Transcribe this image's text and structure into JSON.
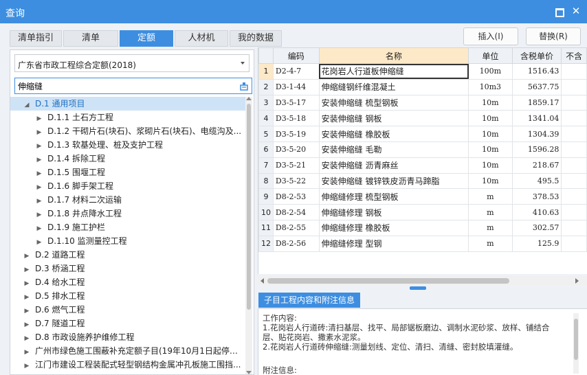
{
  "window": {
    "title": "查询"
  },
  "tabs": [
    {
      "label": "清单指引"
    },
    {
      "label": "清单"
    },
    {
      "label": "定额"
    },
    {
      "label": "人材机"
    },
    {
      "label": "我的数据"
    }
  ],
  "actions": {
    "insert_label": "插入(I)",
    "replace_label": "替换(R)"
  },
  "left": {
    "library": "广东省市政工程综合定额(2018)",
    "search_value": "伸缩缝",
    "tree": [
      {
        "label": "D.1 通用项目",
        "level": 0,
        "expanded": true,
        "selected": true
      },
      {
        "label": "D.1.1 土石方工程",
        "level": 1
      },
      {
        "label": "D.1.2 干砌片石(块石)、浆砌片石(块石)、电缆沟及...",
        "level": 1
      },
      {
        "label": "D.1.3 软基处理、桩及支护工程",
        "level": 1
      },
      {
        "label": "D.1.4 拆除工程",
        "level": 1
      },
      {
        "label": "D.1.5 围堰工程",
        "level": 1
      },
      {
        "label": "D.1.6 脚手架工程",
        "level": 1
      },
      {
        "label": "D.1.7 材料二次运输",
        "level": 1
      },
      {
        "label": "D.1.8 井点降水工程",
        "level": 1
      },
      {
        "label": "D.1.9 施工护栏",
        "level": 1
      },
      {
        "label": "D.1.10 监测量控工程",
        "level": 1
      },
      {
        "label": "D.2 道路工程",
        "level": 0
      },
      {
        "label": "D.3 桥涵工程",
        "level": 0
      },
      {
        "label": "D.4 给水工程",
        "level": 0
      },
      {
        "label": "D.5 排水工程",
        "level": 0
      },
      {
        "label": "D.6 燃气工程",
        "level": 0
      },
      {
        "label": "D.7 隧道工程",
        "level": 0
      },
      {
        "label": "D.8 市政设施养护维修工程",
        "level": 0
      },
      {
        "label": "广州市绿色施工围蔽补充定额子目(19年10月1日起停止...",
        "level": 0
      },
      {
        "label": "江门市建设工程装配式轻型钢结构金属冲孔板施工围挡...",
        "level": 0
      }
    ]
  },
  "grid": {
    "headers": {
      "code": "编码",
      "name": "名称",
      "unit": "单位",
      "price": "含税单价",
      "extra": "不含"
    },
    "rows": [
      {
        "n": "1",
        "code": "D2-4-7",
        "name": "花岗岩人行道板伸缩缝",
        "unit": "100m",
        "price": "1516.43"
      },
      {
        "n": "2",
        "code": "D3-1-44",
        "name": "伸缩缝钢纤维混凝土",
        "unit": "10m3",
        "price": "5637.75"
      },
      {
        "n": "3",
        "code": "D3-5-17",
        "name": "安装伸缩缝 梳型钢板",
        "unit": "10m",
        "price": "1859.17"
      },
      {
        "n": "4",
        "code": "D3-5-18",
        "name": "安装伸缩缝 钢板",
        "unit": "10m",
        "price": "1341.04"
      },
      {
        "n": "5",
        "code": "D3-5-19",
        "name": "安装伸缩缝 橡胶板",
        "unit": "10m",
        "price": "1304.39"
      },
      {
        "n": "6",
        "code": "D3-5-20",
        "name": "安装伸缩缝 毛勒",
        "unit": "10m",
        "price": "1596.28"
      },
      {
        "n": "7",
        "code": "D3-5-21",
        "name": "安装伸缩缝 沥青麻丝",
        "unit": "10m",
        "price": "218.67"
      },
      {
        "n": "8",
        "code": "D3-5-22",
        "name": "安装伸缩缝 镀锌铁皮沥青马蹄脂",
        "unit": "10m",
        "price": "495.5"
      },
      {
        "n": "9",
        "code": "D8-2-53",
        "name": "伸缩缝修理 梳型钢板",
        "unit": "m",
        "price": "378.53"
      },
      {
        "n": "10",
        "code": "D8-2-54",
        "name": "伸缩缝修理 钢板",
        "unit": "m",
        "price": "410.63"
      },
      {
        "n": "11",
        "code": "D8-2-55",
        "name": "伸缩缝修理 橡胶板",
        "unit": "m",
        "price": "302.57"
      },
      {
        "n": "12",
        "code": "D8-2-56",
        "name": "伸缩缝修理 型钢",
        "unit": "m",
        "price": "125.9"
      }
    ]
  },
  "info": {
    "tab_label": "子目工程内容和附注信息",
    "work_title": "工作内容:",
    "line1": "1.花岗岩人行道砖:清扫基层、找平、局部锯板磨边、调制水泥砂浆、放样、铺结合层、贴花岗岩、撒素水泥浆。",
    "line2": "2.花岗岩人行道砖伸缩缝:测量划线、定位、清扫、清缝、密封胶填灌缝。",
    "note_title": "附注信息:"
  },
  "colors": {
    "accent": "#3d8ee0",
    "header_selected": "#fde9c7",
    "tree_selected": "#cfe3f7"
  }
}
